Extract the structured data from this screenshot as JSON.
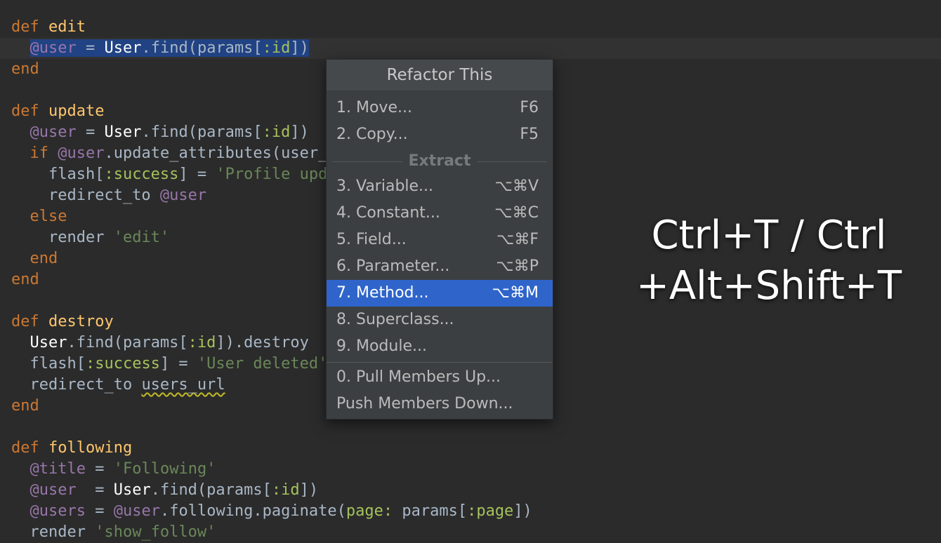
{
  "editor": {
    "lines": [
      {
        "parts": [
          {
            "t": "def",
            "c": "kw"
          },
          {
            "t": " "
          },
          {
            "t": "edit",
            "c": "fn"
          }
        ]
      },
      {
        "parts": [
          {
            "t": "  "
          },
          {
            "t": "@user",
            "c": "ivar sel"
          },
          {
            "t": " = ",
            "c": "sel"
          },
          {
            "t": "User",
            "c": "cls sel"
          },
          {
            "t": ".",
            "c": "sel"
          },
          {
            "t": "find",
            "c": "sel"
          },
          {
            "t": "(params[",
            "c": "sel"
          },
          {
            "t": ":id",
            "c": "sym sel"
          },
          {
            "t": "])",
            "c": "sel"
          }
        ]
      },
      {
        "parts": [
          {
            "t": "end",
            "c": "kw"
          }
        ]
      },
      {
        "parts": []
      },
      {
        "parts": [
          {
            "t": "def",
            "c": "kw"
          },
          {
            "t": " "
          },
          {
            "t": "update",
            "c": "fn"
          }
        ]
      },
      {
        "parts": [
          {
            "t": "  "
          },
          {
            "t": "@user",
            "c": "ivar"
          },
          {
            "t": " = "
          },
          {
            "t": "User",
            "c": "cls"
          },
          {
            "t": ".find(params["
          },
          {
            "t": ":id",
            "c": "sym"
          },
          {
            "t": "])"
          }
        ]
      },
      {
        "parts": [
          {
            "t": "  "
          },
          {
            "t": "if",
            "c": "kw"
          },
          {
            "t": " "
          },
          {
            "t": "@user",
            "c": "ivar"
          },
          {
            "t": ".update_attributes(user_params)"
          }
        ]
      },
      {
        "parts": [
          {
            "t": "    flash["
          },
          {
            "t": ":success",
            "c": "sym"
          },
          {
            "t": "] = "
          },
          {
            "t": "'Profile updated'",
            "c": "str"
          }
        ]
      },
      {
        "parts": [
          {
            "t": "    redirect_to "
          },
          {
            "t": "@user",
            "c": "ivar"
          }
        ]
      },
      {
        "parts": [
          {
            "t": "  "
          },
          {
            "t": "else",
            "c": "kw"
          }
        ]
      },
      {
        "parts": [
          {
            "t": "    render "
          },
          {
            "t": "'edit'",
            "c": "str"
          }
        ]
      },
      {
        "parts": [
          {
            "t": "  "
          },
          {
            "t": "end",
            "c": "kw"
          }
        ]
      },
      {
        "parts": [
          {
            "t": "end",
            "c": "kw"
          }
        ]
      },
      {
        "parts": []
      },
      {
        "parts": [
          {
            "t": "def",
            "c": "kw"
          },
          {
            "t": " "
          },
          {
            "t": "destroy",
            "c": "fn"
          }
        ]
      },
      {
        "parts": [
          {
            "t": "  "
          },
          {
            "t": "User",
            "c": "cls"
          },
          {
            "t": ".find(params["
          },
          {
            "t": ":id",
            "c": "sym"
          },
          {
            "t": "]).destroy"
          }
        ]
      },
      {
        "parts": [
          {
            "t": "  flash["
          },
          {
            "t": ":success",
            "c": "sym"
          },
          {
            "t": "] = "
          },
          {
            "t": "'User deleted'",
            "c": "str"
          }
        ]
      },
      {
        "parts": [
          {
            "t": "  redirect_to "
          },
          {
            "t": "users_url",
            "c": "squig"
          }
        ]
      },
      {
        "parts": [
          {
            "t": "end",
            "c": "kw"
          }
        ]
      },
      {
        "parts": []
      },
      {
        "parts": [
          {
            "t": "def",
            "c": "kw"
          },
          {
            "t": " "
          },
          {
            "t": "following",
            "c": "fn"
          }
        ]
      },
      {
        "parts": [
          {
            "t": "  "
          },
          {
            "t": "@title",
            "c": "ivar"
          },
          {
            "t": " = "
          },
          {
            "t": "'Following'",
            "c": "str"
          }
        ]
      },
      {
        "parts": [
          {
            "t": "  "
          },
          {
            "t": "@user",
            "c": "ivar"
          },
          {
            "t": "  = "
          },
          {
            "t": "User",
            "c": "cls"
          },
          {
            "t": ".find(params["
          },
          {
            "t": ":id",
            "c": "sym"
          },
          {
            "t": "])"
          }
        ]
      },
      {
        "parts": [
          {
            "t": "  "
          },
          {
            "t": "@users",
            "c": "ivar"
          },
          {
            "t": " = "
          },
          {
            "t": "@user",
            "c": "ivar"
          },
          {
            "t": ".following.paginate("
          },
          {
            "t": "page:",
            "c": "sym"
          },
          {
            "t": " params["
          },
          {
            "t": ":page",
            "c": "sym"
          },
          {
            "t": "])"
          }
        ]
      },
      {
        "parts": [
          {
            "t": "  render "
          },
          {
            "t": "'show_follow'",
            "c": "str"
          }
        ]
      }
    ]
  },
  "popup": {
    "title": "Refactor This",
    "group1": [
      {
        "label": "1. Move...",
        "key": "F6"
      },
      {
        "label": "2. Copy...",
        "key": "F5"
      }
    ],
    "extract_title": "Extract",
    "group2": [
      {
        "label": "3. Variable...",
        "key": "⌥⌘V"
      },
      {
        "label": "4. Constant...",
        "key": "⌥⌘C"
      },
      {
        "label": "5. Field...",
        "key": "⌥⌘F"
      },
      {
        "label": "6. Parameter...",
        "key": "⌥⌘P"
      },
      {
        "label": "7. Method...",
        "key": "⌥⌘M",
        "active": true
      },
      {
        "label": "8. Superclass...",
        "key": ""
      },
      {
        "label": "9. Module...",
        "key": ""
      }
    ],
    "group3": [
      {
        "label": "0. Pull Members Up...",
        "key": ""
      },
      {
        "label": "Push Members Down...",
        "key": ""
      }
    ]
  },
  "shortcut": {
    "line1": "Ctrl+T / Ctrl",
    "line2": "+Alt+Shift+T"
  }
}
